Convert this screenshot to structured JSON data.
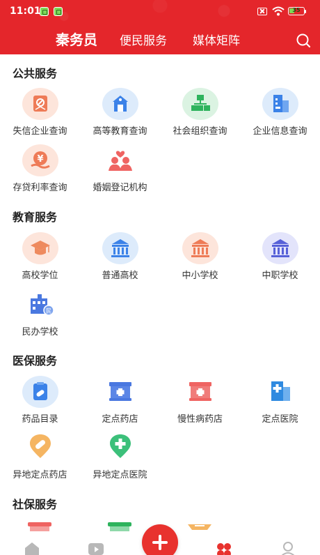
{
  "status_bar": {
    "time": "11:01",
    "battery_level": "35",
    "battery_fraction": 0.35
  },
  "nav": {
    "tabs": [
      {
        "label": "秦务员",
        "active": true
      },
      {
        "label": "便民服务",
        "active": false
      },
      {
        "label": "媒体矩阵",
        "active": false
      }
    ],
    "search_icon": "search-icon"
  },
  "sections": [
    {
      "title": "公共服务",
      "items": [
        {
          "label": "失信企业查询",
          "icon": "blocked-enterprise-icon",
          "bg": "#fde5db",
          "color": "#ee7b57"
        },
        {
          "label": "高等教育查询",
          "icon": "university-building-icon",
          "bg": "#ddebfb",
          "color": "#3b82e8"
        },
        {
          "label": "社会组织查询",
          "icon": "org-chart-icon",
          "bg": "#dbf3e2",
          "color": "#2eb35d"
        },
        {
          "label": "企业信息查询",
          "icon": "company-building-icon",
          "bg": "#ddebfb",
          "color": "#3b82e8"
        },
        {
          "label": "存贷利率查询",
          "icon": "yen-coin-icon",
          "bg": "#fde5db",
          "color": "#ee7b57"
        },
        {
          "label": "婚姻登记机构",
          "icon": "couple-heart-icon",
          "bg": "#ffffff",
          "color": "#ef6462"
        }
      ]
    },
    {
      "title": "教育服务",
      "items": [
        {
          "label": "高校学位",
          "icon": "graduation-cap-icon",
          "bg": "#fde5db",
          "color": "#ee8a5e"
        },
        {
          "label": "普通高校",
          "icon": "college-pillars-icon",
          "bg": "#ddebfb",
          "color": "#3b82e8"
        },
        {
          "label": "中小学校",
          "icon": "school-pillars-icon",
          "bg": "#fde5db",
          "color": "#ee7b57"
        },
        {
          "label": "中职学校",
          "icon": "vocational-pillars-icon",
          "bg": "#e3e4fb",
          "color": "#5660d8"
        },
        {
          "label": "民办学校",
          "icon": "private-school-icon",
          "bg": "#ffffff",
          "color": "#4a78e0"
        }
      ]
    },
    {
      "title": "医保服务",
      "items": [
        {
          "label": "药品目录",
          "icon": "medicine-list-icon",
          "bg": "#ddebfb",
          "color": "#3b82e8"
        },
        {
          "label": "定点药店",
          "icon": "pharmacy-store-icon",
          "bg": "#ffffff",
          "color": "#4a78e0"
        },
        {
          "label": "慢性病药店",
          "icon": "chronic-pharmacy-icon",
          "bg": "#ffffff",
          "color": "#ef6462"
        },
        {
          "label": "定点医院",
          "icon": "hospital-icon",
          "bg": "#ffffff",
          "color": "#2f8ae0"
        },
        {
          "label": "异地定点药店",
          "icon": "remote-pharmacy-pin-icon",
          "bg": "#ffffff",
          "color": "#f09a3e"
        },
        {
          "label": "异地定点医院",
          "icon": "remote-hospital-pin-icon",
          "bg": "#ffffff",
          "color": "#2eb35d"
        }
      ]
    },
    {
      "title": "社保服务",
      "items": [
        {
          "label": "",
          "icon": "social-card-red-icon",
          "bg": "#ffffff",
          "color": "#ef6462"
        },
        {
          "label": "",
          "icon": "social-card-green-icon",
          "bg": "#ffffff",
          "color": "#2eb35d"
        },
        {
          "label": "",
          "icon": "social-card-orange-icon",
          "bg": "#ffffff",
          "color": "#f09a3e"
        }
      ]
    }
  ],
  "bottom_nav": {
    "items": [
      {
        "icon": "home-icon"
      },
      {
        "icon": "video-icon"
      },
      {
        "icon": "add-icon"
      },
      {
        "icon": "services-icon"
      },
      {
        "icon": "profile-icon"
      }
    ]
  },
  "colors": {
    "brand_red": "#e4262b",
    "fab_red": "#e8322e",
    "services_active": "#e8322e",
    "inactive_gray": "#b8b8b8"
  }
}
